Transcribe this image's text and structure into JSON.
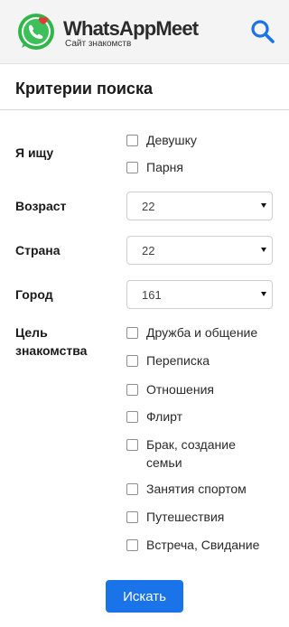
{
  "header": {
    "brand_name": "WhatsAppMeet",
    "brand_subtitle": "Сайт знакомств",
    "logo_icon": "whatsapp-heart-logo",
    "search_icon": "search-icon",
    "accent_color": "#1a73e8"
  },
  "page": {
    "title": "Критерии поиска"
  },
  "form": {
    "seeking": {
      "label": "Я ищу",
      "options": [
        "Девушку",
        "Парня"
      ]
    },
    "age": {
      "label": "Возраст",
      "value": "22"
    },
    "country": {
      "label": "Страна",
      "value": "22"
    },
    "city": {
      "label": "Город",
      "value": "161"
    },
    "purpose": {
      "label_line1": "Цель",
      "label_line2": "знакомства",
      "options": [
        "Дружба и общение",
        "Переписка",
        "Отношения",
        "Флирт",
        "Брак, создание семьи",
        "Занятия спортом",
        "Путешествия",
        "Встреча, Свидание"
      ]
    },
    "submit_label": "Искать"
  }
}
